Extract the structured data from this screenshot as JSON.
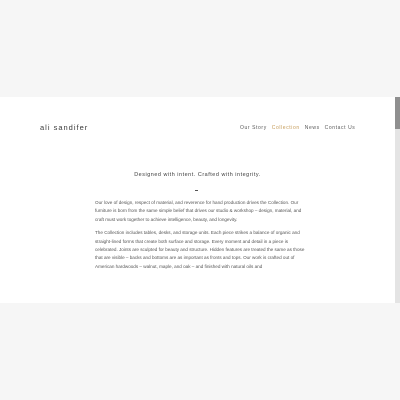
{
  "site": {
    "title": "ali sandifer"
  },
  "nav": {
    "items": [
      {
        "label": "Our Story",
        "active": false
      },
      {
        "label": "Collection",
        "active": true
      },
      {
        "label": "News",
        "active": false
      },
      {
        "label": "Contact Us",
        "active": false
      }
    ]
  },
  "main": {
    "tagline": "Designed with intent. Crafted with integrity.",
    "separator": "–",
    "paragraphs": [
      "Our love of design, respect of material, and reverence for hand production drives the Collection. Our furniture is born from the same simple belief that drives our studio & workshop – design, material, and craft must work together to achieve intelligence, beauty, and longevity.",
      "The Collection includes tables, desks, and storage units. Each piece strikes a balance of organic and straight-lined forms that create both surface and storage. Every moment and detail in a piece is celebrated. Joints are sculpted for beauty and structure. Hidden features are treated the same as those that are visible – backs and bottoms are as important as fronts and tops. Our work is crafted out of American hardwoods – walnut, maple, and oak – and finished with natural oils and"
    ]
  },
  "colors": {
    "page_background": "#f6f6f6",
    "content_background": "#ffffff",
    "accent": "#c49a57",
    "text": "#4a4a4a"
  }
}
